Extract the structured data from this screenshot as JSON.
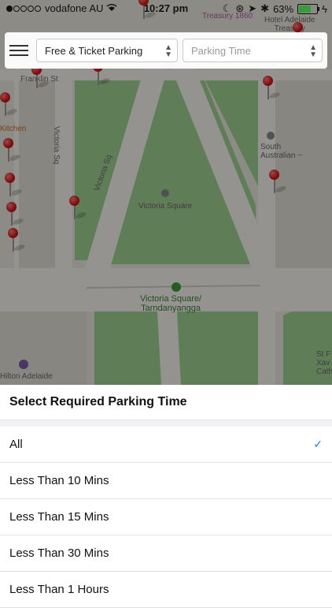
{
  "status_bar": {
    "carrier": "vodafone AU",
    "time": "10:27 pm",
    "battery": "63%"
  },
  "map": {
    "labels": {
      "franklin": "Franklin St",
      "victoria_sq_street": "Victoria Sq",
      "victoria_sq_road": "Victoria Sq",
      "victoria_square": "Victoria Square",
      "tram_stop": "Victoria Square/\nTarndanyangga",
      "south_australian": "South\nAustralian ~",
      "treasury": "Treasury 1860",
      "hotel": "Hotel Adelaide\nTreasury",
      "kitchen": "Kitchen",
      "hilton": "Hilton Adelaide",
      "st_francis": "St F\nXav\nCath"
    }
  },
  "toolbar": {
    "filter_value": "Free & Ticket Parking",
    "time_placeholder": "Parking Time"
  },
  "sheet": {
    "title": "Select Required Parking Time",
    "options": [
      {
        "label": "All",
        "selected": true
      },
      {
        "label": "Less Than 10 Mins",
        "selected": false
      },
      {
        "label": "Less Than 15 Mins",
        "selected": false
      },
      {
        "label": "Less Than 30 Mins",
        "selected": false
      },
      {
        "label": "Less Than 1 Hours",
        "selected": false
      }
    ],
    "check_mark": "✓",
    "accent_color": "#1e7df0"
  }
}
